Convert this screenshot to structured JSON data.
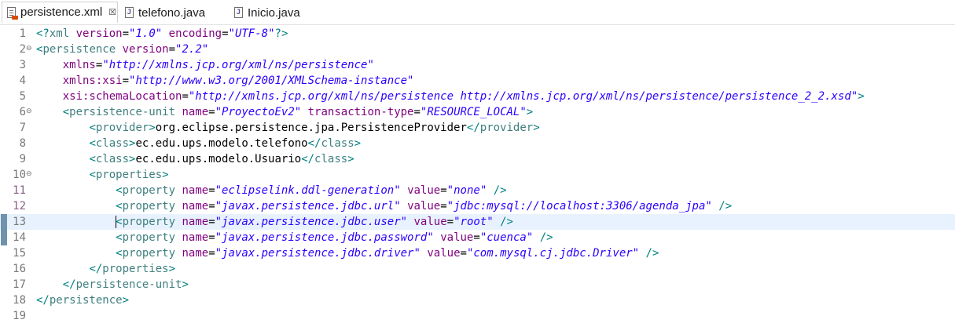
{
  "tabs": [
    {
      "label": "persistence.xml",
      "icon": "xml-file-icon",
      "active": true,
      "close": "☒"
    },
    {
      "label": "telefono.java",
      "icon": "java-file-icon",
      "active": false
    },
    {
      "label": "Inicio.java",
      "icon": "java-file-icon",
      "active": false
    }
  ],
  "editor": {
    "current_line": 13,
    "lines": [
      {
        "num": "1",
        "fold": "",
        "tokens": [
          [
            "p",
            "<?"
          ],
          [
            "t",
            "xml"
          ],
          [
            "x",
            " "
          ],
          [
            "a",
            "version"
          ],
          [
            "x",
            "="
          ],
          [
            "v",
            "\"1.0\""
          ],
          [
            "x",
            " "
          ],
          [
            "a",
            "encoding"
          ],
          [
            "x",
            "="
          ],
          [
            "v",
            "\"UTF-8\""
          ],
          [
            "p",
            "?>"
          ]
        ]
      },
      {
        "num": "2",
        "fold": "⊖",
        "tokens": [
          [
            "p",
            "<"
          ],
          [
            "t",
            "persistence"
          ],
          [
            "x",
            " "
          ],
          [
            "a",
            "version"
          ],
          [
            "x",
            "="
          ],
          [
            "v",
            "\"2.2\""
          ]
        ]
      },
      {
        "num": "3",
        "fold": "",
        "tokens": [
          [
            "x",
            "    "
          ],
          [
            "a",
            "xmlns"
          ],
          [
            "x",
            "="
          ],
          [
            "v",
            "\"http://xmlns.jcp.org/xml/ns/persistence\""
          ]
        ]
      },
      {
        "num": "4",
        "fold": "",
        "tokens": [
          [
            "x",
            "    "
          ],
          [
            "a",
            "xmlns:xsi"
          ],
          [
            "x",
            "="
          ],
          [
            "v",
            "\"http://www.w3.org/2001/XMLSchema-instance\""
          ]
        ]
      },
      {
        "num": "5",
        "fold": "",
        "tokens": [
          [
            "x",
            "    "
          ],
          [
            "a",
            "xsi:schemaLocation"
          ],
          [
            "x",
            "="
          ],
          [
            "v",
            "\"http://xmlns.jcp.org/xml/ns/persistence http://xmlns.jcp.org/xml/ns/persistence/persistence_2_2.xsd\""
          ],
          [
            "p",
            ">"
          ]
        ]
      },
      {
        "num": "6",
        "fold": "⊖",
        "tokens": [
          [
            "x",
            "    "
          ],
          [
            "p",
            "<"
          ],
          [
            "t",
            "persistence-unit"
          ],
          [
            "x",
            " "
          ],
          [
            "a",
            "name"
          ],
          [
            "x",
            "="
          ],
          [
            "v",
            "\"ProyectoEv2\""
          ],
          [
            "x",
            " "
          ],
          [
            "a",
            "transaction-type"
          ],
          [
            "x",
            "="
          ],
          [
            "v",
            "\"RESOURCE_LOCAL\""
          ],
          [
            "p",
            ">"
          ]
        ]
      },
      {
        "num": "7",
        "fold": "",
        "tokens": [
          [
            "x",
            "        "
          ],
          [
            "p",
            "<"
          ],
          [
            "t",
            "provider"
          ],
          [
            "p",
            ">"
          ],
          [
            "x",
            "org.eclipse.persistence.jpa.PersistenceProvider"
          ],
          [
            "p",
            "</"
          ],
          [
            "t",
            "provider"
          ],
          [
            "p",
            ">"
          ]
        ]
      },
      {
        "num": "8",
        "fold": "",
        "tokens": [
          [
            "x",
            "        "
          ],
          [
            "p",
            "<"
          ],
          [
            "t",
            "class"
          ],
          [
            "p",
            ">"
          ],
          [
            "x",
            "ec.edu.ups.modelo.telefono"
          ],
          [
            "p",
            "</"
          ],
          [
            "t",
            "class"
          ],
          [
            "p",
            ">"
          ]
        ]
      },
      {
        "num": "9",
        "fold": "",
        "tokens": [
          [
            "x",
            "        "
          ],
          [
            "p",
            "<"
          ],
          [
            "t",
            "class"
          ],
          [
            "p",
            ">"
          ],
          [
            "x",
            "ec.edu.ups.modelo.Usuario"
          ],
          [
            "p",
            "</"
          ],
          [
            "t",
            "class"
          ],
          [
            "p",
            ">"
          ]
        ]
      },
      {
        "num": "10",
        "fold": "⊖",
        "tokens": [
          [
            "x",
            "        "
          ],
          [
            "p",
            "<"
          ],
          [
            "t",
            "properties"
          ],
          [
            "p",
            ">"
          ]
        ]
      },
      {
        "num": "11",
        "fold": "",
        "mod": true,
        "tokens": [
          [
            "x",
            "            "
          ],
          [
            "p",
            "<"
          ],
          [
            "t",
            "property"
          ],
          [
            "x",
            " "
          ],
          [
            "a",
            "name"
          ],
          [
            "x",
            "="
          ],
          [
            "v",
            "\"eclipselink.ddl-generation\""
          ],
          [
            "x",
            " "
          ],
          [
            "a",
            "value"
          ],
          [
            "x",
            "="
          ],
          [
            "v",
            "\"none\""
          ],
          [
            "x",
            " "
          ],
          [
            "p",
            "/>"
          ]
        ]
      },
      {
        "num": "12",
        "fold": "",
        "mod": true,
        "tokens": [
          [
            "x",
            "            "
          ],
          [
            "p",
            "<"
          ],
          [
            "t",
            "property"
          ],
          [
            "x",
            " "
          ],
          [
            "a",
            "name"
          ],
          [
            "x",
            "="
          ],
          [
            "v",
            "\"javax.persistence.jdbc.url\""
          ],
          [
            "x",
            " "
          ],
          [
            "a",
            "value"
          ],
          [
            "x",
            "="
          ],
          [
            "v",
            "\"jdbc:mysql://localhost:3306/agenda_jpa\""
          ],
          [
            "x",
            " "
          ],
          [
            "p",
            "/>"
          ]
        ]
      },
      {
        "num": "13",
        "fold": "",
        "mark": true,
        "caret": true,
        "tokens": [
          [
            "x",
            "            "
          ],
          [
            "p",
            "<"
          ],
          [
            "t",
            "property"
          ],
          [
            "x",
            " "
          ],
          [
            "a",
            "name"
          ],
          [
            "x",
            "="
          ],
          [
            "v",
            "\"javax.persistence.jdbc.user\""
          ],
          [
            "x",
            " "
          ],
          [
            "a",
            "value"
          ],
          [
            "x",
            "="
          ],
          [
            "v",
            "\"root\""
          ],
          [
            "x",
            " "
          ],
          [
            "p",
            "/>"
          ]
        ]
      },
      {
        "num": "14",
        "fold": "",
        "mark": true,
        "tokens": [
          [
            "x",
            "            "
          ],
          [
            "p",
            "<"
          ],
          [
            "t",
            "property"
          ],
          [
            "x",
            " "
          ],
          [
            "a",
            "name"
          ],
          [
            "x",
            "="
          ],
          [
            "v",
            "\"javax.persistence.jdbc.password\""
          ],
          [
            "x",
            " "
          ],
          [
            "a",
            "value"
          ],
          [
            "x",
            "="
          ],
          [
            "v",
            "\"cuenca\""
          ],
          [
            "x",
            " "
          ],
          [
            "p",
            "/>"
          ]
        ]
      },
      {
        "num": "15",
        "fold": "",
        "tokens": [
          [
            "x",
            "            "
          ],
          [
            "p",
            "<"
          ],
          [
            "t",
            "property"
          ],
          [
            "x",
            " "
          ],
          [
            "a",
            "name"
          ],
          [
            "x",
            "="
          ],
          [
            "v",
            "\"javax.persistence.jdbc.driver\""
          ],
          [
            "x",
            " "
          ],
          [
            "a",
            "value"
          ],
          [
            "x",
            "="
          ],
          [
            "v",
            "\"com.mysql.cj.jdbc.Driver\""
          ],
          [
            "x",
            " "
          ],
          [
            "p",
            "/>"
          ]
        ]
      },
      {
        "num": "16",
        "fold": "",
        "tokens": [
          [
            "x",
            "        "
          ],
          [
            "p",
            "</"
          ],
          [
            "t",
            "properties"
          ],
          [
            "p",
            ">"
          ]
        ]
      },
      {
        "num": "17",
        "fold": "",
        "tokens": [
          [
            "x",
            "    "
          ],
          [
            "p",
            "</"
          ],
          [
            "t",
            "persistence-unit"
          ],
          [
            "p",
            ">"
          ]
        ]
      },
      {
        "num": "18",
        "fold": "",
        "tokens": [
          [
            "p",
            "</"
          ],
          [
            "t",
            "persistence"
          ],
          [
            "p",
            ">"
          ]
        ]
      },
      {
        "num": "19",
        "fold": "",
        "tokens": []
      }
    ]
  }
}
